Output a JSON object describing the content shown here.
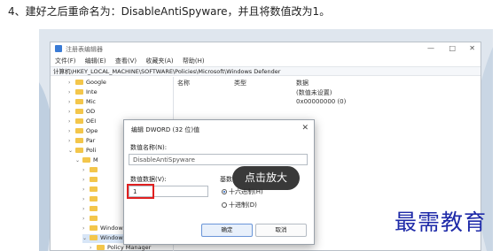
{
  "caption": "4、建好之后重命名为：DisableAntiSpyware，并且将数值改为1。",
  "regedit": {
    "title": "注册表编辑器",
    "win_min": "—",
    "win_max": "□",
    "win_close": "✕",
    "menus": [
      "文件(F)",
      "编辑(E)",
      "查看(V)",
      "收藏夹(A)",
      "帮助(H)"
    ],
    "address": "计算机\\HKEY_LOCAL_MACHINE\\SOFTWARE\\Policies\\Microsoft\\Windows Defender",
    "tree": [
      {
        "label": "Google"
      },
      {
        "label": "Inte"
      },
      {
        "label": "Mic"
      },
      {
        "label": "OD"
      },
      {
        "label": "OEI"
      },
      {
        "label": "Ope"
      },
      {
        "label": "Par"
      },
      {
        "label": "Poli"
      },
      {
        "label": "M"
      },
      {
        "label": ""
      },
      {
        "label": ""
      },
      {
        "label": ""
      },
      {
        "label": ""
      },
      {
        "label": ""
      },
      {
        "label": ""
      },
      {
        "label": "Windows Advanced"
      },
      {
        "label": "Windows Defender"
      },
      {
        "label": "Policy Manager"
      }
    ],
    "columns": {
      "name": "名称",
      "type": "类型",
      "data": "数据"
    },
    "value_cells": [
      "(数值未设置)",
      "0x00000000 (0)"
    ]
  },
  "dialog": {
    "title": "编辑 DWORD (32 位)值",
    "close": "✕",
    "name_label": "数值名称(N):",
    "name_value": "DisableAntiSpyware",
    "data_label": "数值数据(V):",
    "data_value": "1",
    "base_label": "基数",
    "hex_label": "十六进制(H)",
    "dec_label": "十进制(D)",
    "ok_label": "确定",
    "cancel_label": "取消"
  },
  "zoom_hint": "点击放大",
  "watermark": "最需教育"
}
